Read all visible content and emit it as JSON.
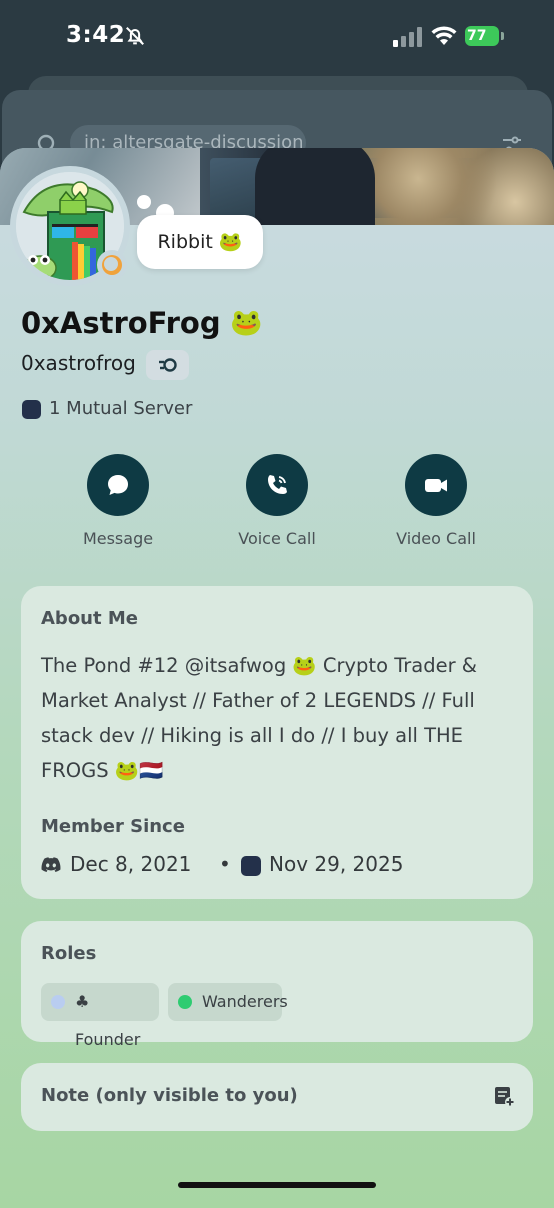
{
  "status_bar": {
    "time": "3:42",
    "battery": "77"
  },
  "background": {
    "search_placeholder": "in: altersgate-discussion"
  },
  "profile": {
    "status_bubble": "Ribbit 🐸",
    "display_name": "0xAstroFrog",
    "display_name_emoji": "🐸",
    "username": "0xastrofrog",
    "mutual_servers": "1 Mutual Server"
  },
  "actions": [
    {
      "label": "Message",
      "icon": "chat-bubble-icon"
    },
    {
      "label": "Voice Call",
      "icon": "phone-icon"
    },
    {
      "label": "Video Call",
      "icon": "video-camera-icon"
    }
  ],
  "about": {
    "title": "About Me",
    "bio": "The Pond #12 @itsafwog 🐸 Crypto Trader & Market Analyst // Father of 2 LEGENDS // Full stack dev // Hiking is all I do // I buy all THE FROGS 🐸🇳🇱",
    "member_since_title": "Member Since",
    "discord_date": "Dec 8, 2021",
    "separator": "•",
    "server_date": "Nov 29, 2025"
  },
  "roles": {
    "title": "Roles",
    "items": [
      {
        "name": "♣ Founder",
        "color": "#b9cdf0"
      },
      {
        "name": "Wanderers",
        "color": "#2ecc71"
      }
    ]
  },
  "note": {
    "title": "Note (only visible to you)"
  },
  "colors": {
    "action_circle": "#0e3a44",
    "card_bg": "#dae9e0",
    "battery": "#3dc95a"
  }
}
